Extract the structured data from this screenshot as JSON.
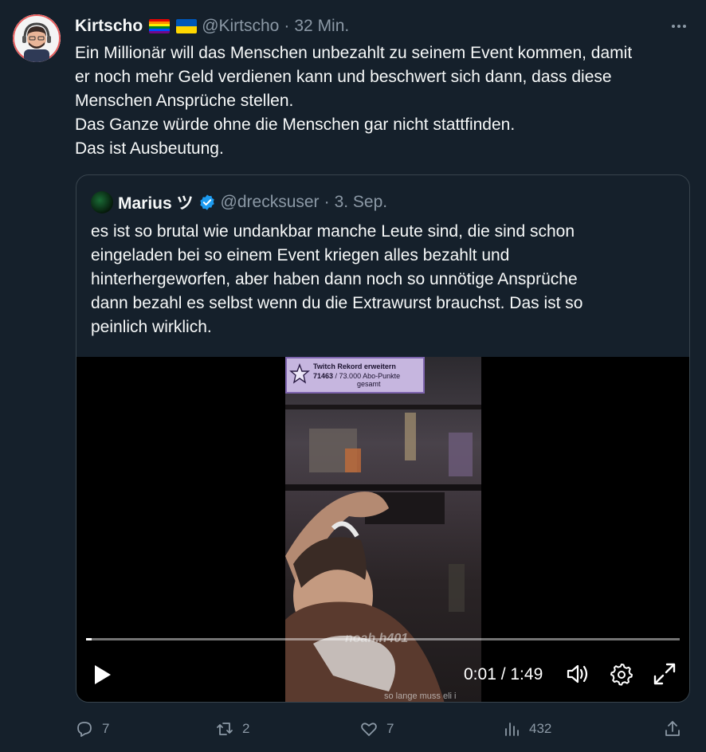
{
  "tweet": {
    "author_name": "Kirtscho",
    "handle": "@Kirtscho",
    "separator": "·",
    "time": "32 Min.",
    "more_icon": "more-horizontal-icon",
    "lines": [
      "Ein Millionär will das Menschen unbezahlt zu seinem Event kommen, damit",
      "er noch mehr Geld verdienen kann und beschwert sich dann, dass diese",
      "Menschen Ansprüche stellen.",
      "Das Ganze würde ohne die Menschen gar nicht stattfinden.",
      "Das ist Ausbeutung."
    ]
  },
  "quote": {
    "author_name": "Marius ツ",
    "handle": "@drecksuser",
    "separator": "·",
    "date": "3. Sep.",
    "lines": [
      "es ist so brutal wie undankbar manche Leute sind, die sind schon",
      "eingeladen bei so einem Event kriegen alles bezahlt und",
      "hinterhergeworfen, aber haben dann noch so unnötige Ansprüche",
      "dann bezahl es selbst wenn du die Extrawurst brauchst. Das ist so",
      "peinlich wirklich."
    ],
    "video": {
      "overlay_title": "Twitch Rekord erweitern",
      "overlay_current": "71463",
      "overlay_rest": "/ 73.000 Abo-Punkte",
      "overlay_suffix": "gesamt",
      "watermark": "noah.h401",
      "subtitle": "so lange muss eli i",
      "time_display": "0:01 / 1:49",
      "progress": 0.01
    }
  },
  "actions": {
    "replies": "7",
    "retweets": "2",
    "likes": "7",
    "views": "432"
  },
  "colors": {
    "background": "#15202b",
    "text": "#f7f9f9",
    "muted": "#8b98a5",
    "border": "#38444d",
    "verified": "#1d9bf0"
  }
}
